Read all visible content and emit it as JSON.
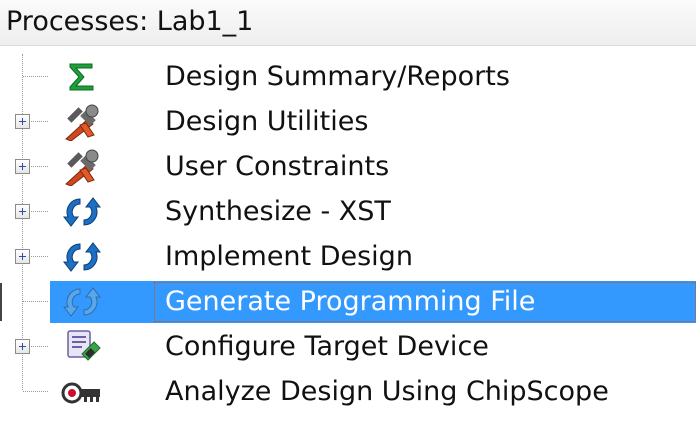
{
  "header": {
    "title": "Processes: Lab1_1"
  },
  "processes": [
    {
      "label": "Design Summary/Reports",
      "icon": "sigma-icon",
      "expandable": false,
      "selected": false
    },
    {
      "label": "Design Utilities",
      "icon": "tools-icon",
      "expandable": true,
      "selected": false
    },
    {
      "label": "User Constraints",
      "icon": "tools-icon",
      "expandable": true,
      "selected": false
    },
    {
      "label": "Synthesize - XST",
      "icon": "refresh-arrows-icon",
      "expandable": true,
      "selected": false
    },
    {
      "label": "Implement Design",
      "icon": "refresh-arrows-icon",
      "expandable": true,
      "selected": false
    },
    {
      "label": "Generate Programming File",
      "icon": "refresh-arrows-icon",
      "expandable": false,
      "selected": true
    },
    {
      "label": "Configure Target Device",
      "icon": "device-config-icon",
      "expandable": true,
      "selected": false
    },
    {
      "label": "Analyze Design Using ChipScope",
      "icon": "chipscope-icon",
      "expandable": false,
      "selected": false
    }
  ],
  "colors": {
    "selection": "#3399ff",
    "sigma": "#1f9e3c",
    "tools": "#d2461e",
    "refresh": "#1d6fc2"
  }
}
